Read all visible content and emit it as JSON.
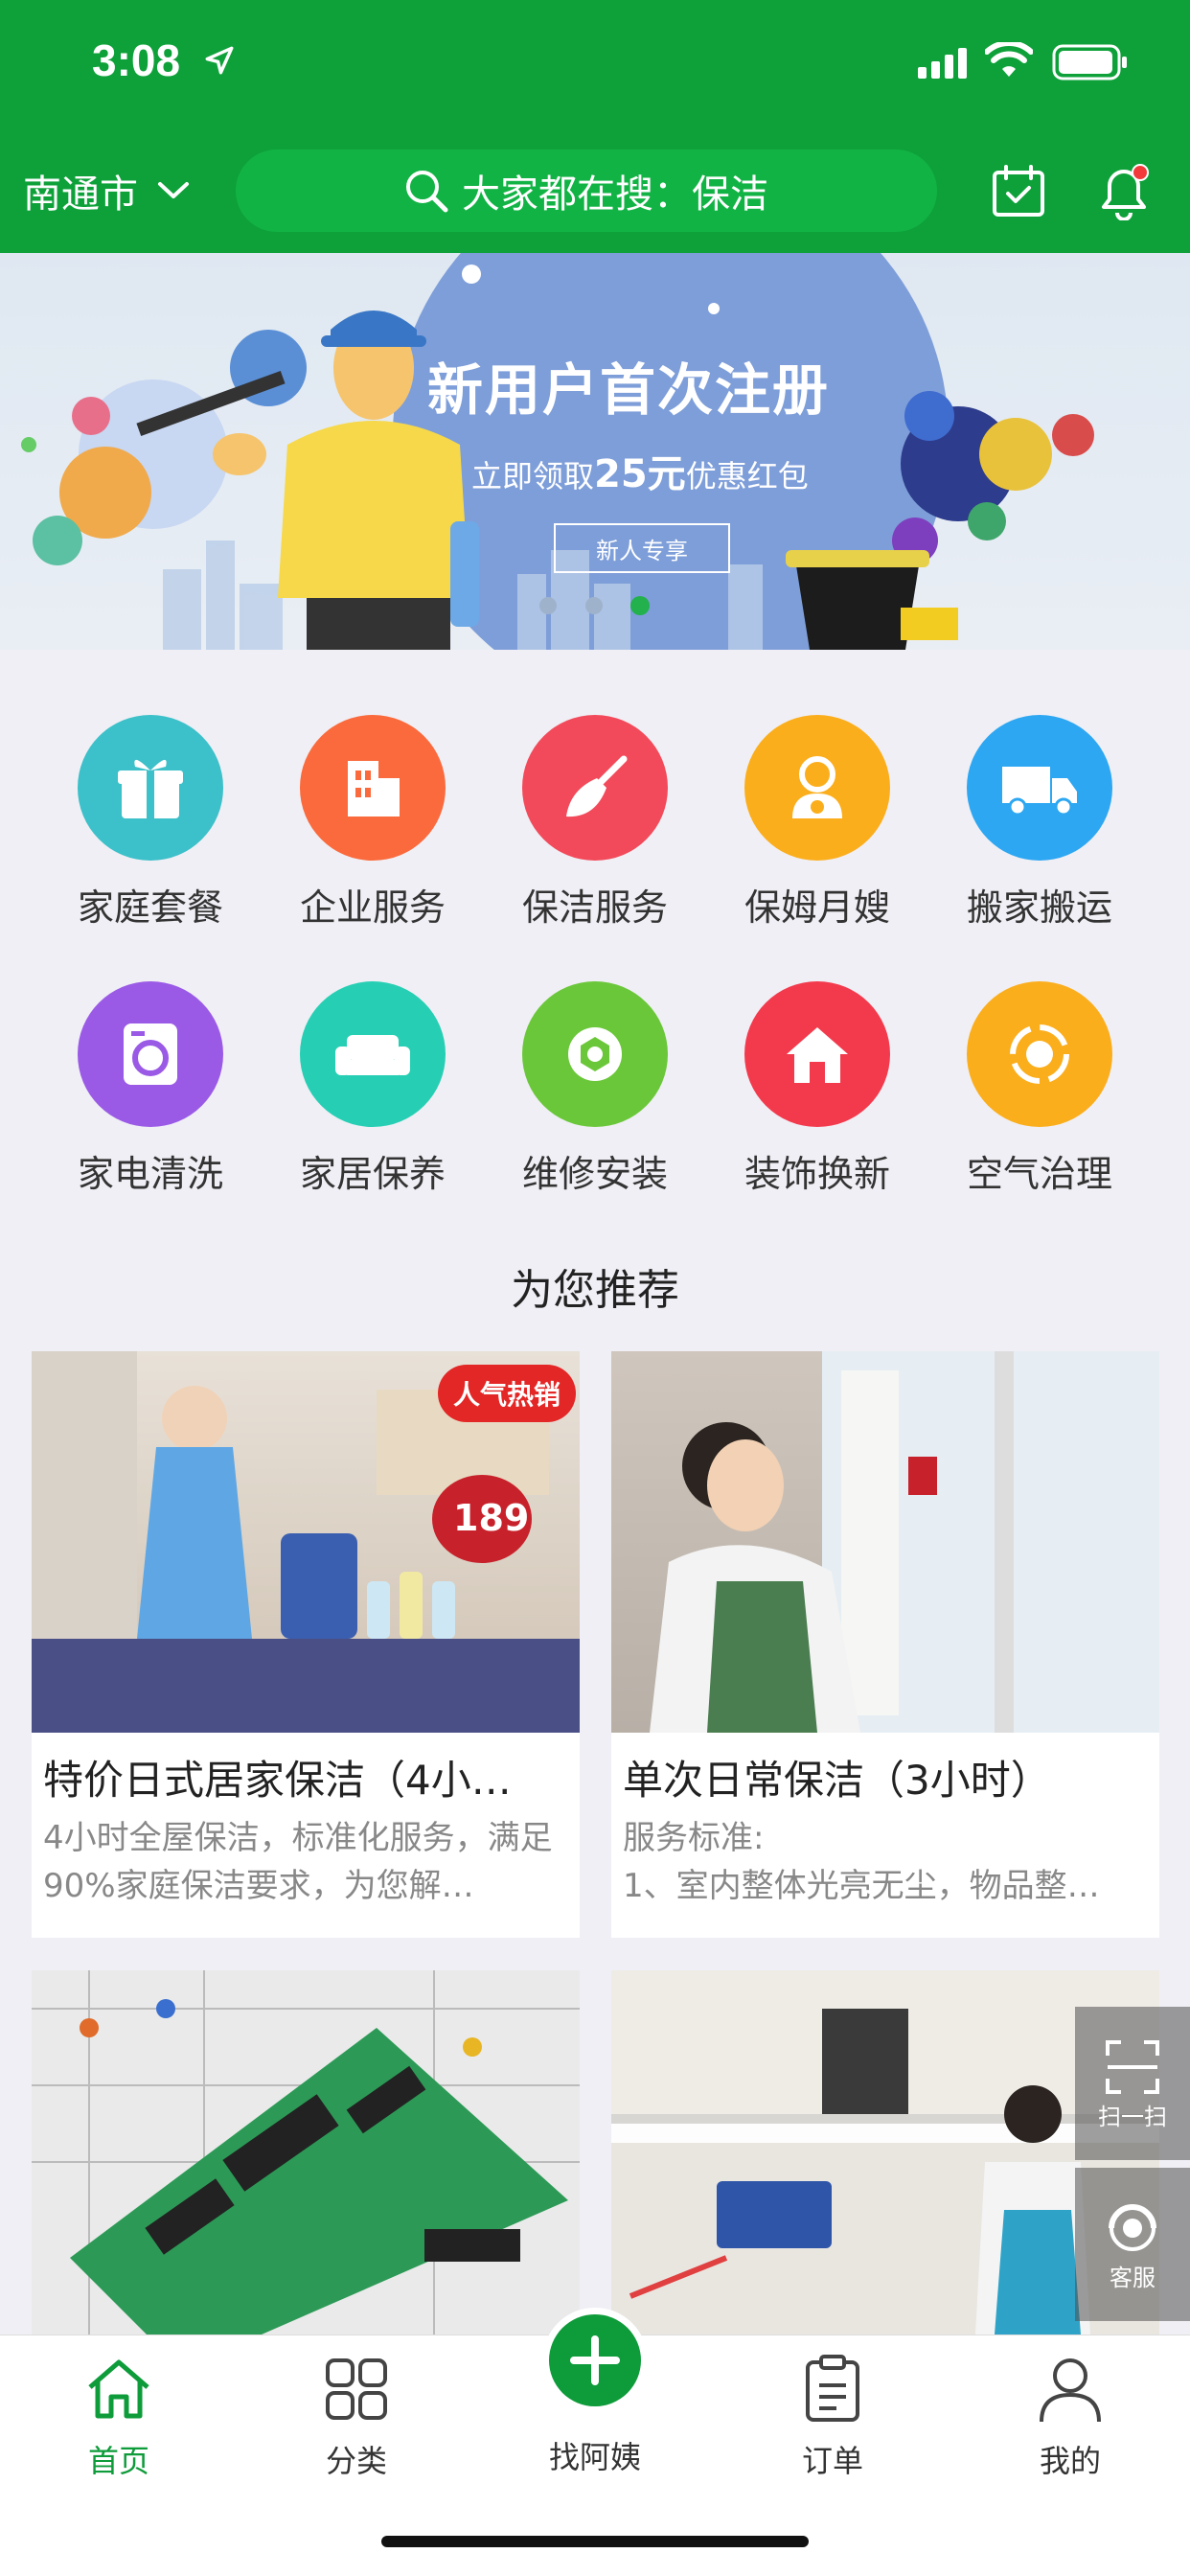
{
  "status_bar": {
    "time": "3:08"
  },
  "header": {
    "city": "南通市",
    "search_placeholder": "大家都在搜：保洁"
  },
  "banner": {
    "title": "新用户首次注册",
    "subtitle_prefix": "立即领取",
    "subtitle_amount": "25元",
    "subtitle_suffix": "优惠红包",
    "button": "新人专享"
  },
  "categories": [
    {
      "label": "家庭套餐",
      "color": "#3cc0c9",
      "icon": "gift-icon"
    },
    {
      "label": "企业服务",
      "color": "#fa6a3c",
      "icon": "building-icon"
    },
    {
      "label": "保洁服务",
      "color": "#f24a5a",
      "icon": "broom-icon"
    },
    {
      "label": "保姆月嫂",
      "color": "#fbae1c",
      "icon": "nanny-icon"
    },
    {
      "label": "搬家搬运",
      "color": "#2da7f2",
      "icon": "truck-icon"
    },
    {
      "label": "家电清洗",
      "color": "#9a5ae6",
      "icon": "washer-icon"
    },
    {
      "label": "家居保养",
      "color": "#26cfb4",
      "icon": "sofa-icon"
    },
    {
      "label": "维修安装",
      "color": "#6bc73a",
      "icon": "wrench-icon"
    },
    {
      "label": "装饰换新",
      "color": "#f33a4d",
      "icon": "house-icon"
    },
    {
      "label": "空气治理",
      "color": "#fbae1c",
      "icon": "air-icon"
    }
  ],
  "recommend": {
    "title": "为您推荐",
    "items": [
      {
        "title": "特价日式居家保洁（4小…",
        "desc": "4小时全屋保洁，标准化服务，满足90%家庭保洁要求，为您解…",
        "badge": "人气热销",
        "price": "189"
      },
      {
        "title": "单次日常保洁（3小时）",
        "desc": "服务标准:\n1、室内整体光亮无尘，物品整…"
      },
      {
        "title": "",
        "desc": ""
      },
      {
        "title": "",
        "desc": ""
      }
    ]
  },
  "side_tools": {
    "scan": "扫一扫",
    "service": "客服"
  },
  "tabbar": {
    "tabs": [
      {
        "label": "首页",
        "icon": "home-icon"
      },
      {
        "label": "分类",
        "icon": "grid-icon"
      },
      {
        "label": "找阿姨",
        "icon": "plus-icon"
      },
      {
        "label": "订单",
        "icon": "clipboard-icon"
      },
      {
        "label": "我的",
        "icon": "user-icon"
      }
    ]
  },
  "colors": {
    "brand_green": "#0ea13a",
    "search_green": "#12b345"
  }
}
